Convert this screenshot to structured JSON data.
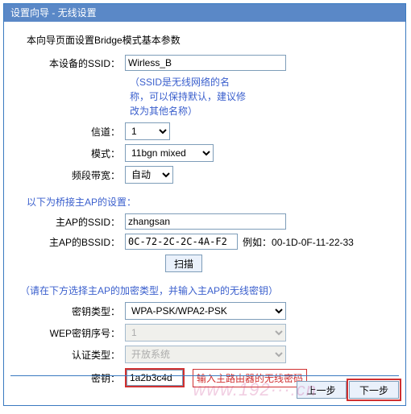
{
  "window": {
    "title": "设置向导 - 无线设置"
  },
  "intro": "本向导页面设置Bridge模式基本参数",
  "fields": {
    "device_ssid": {
      "label": "本设备的SSID：",
      "value": "Wirless_B"
    },
    "ssid_hint": "（SSID是无线网络的名称，可以保持默认，建议修改为其他名称）",
    "channel": {
      "label": "信道：",
      "value": "1"
    },
    "mode": {
      "label": "模式：",
      "value": "11bgn mixed"
    },
    "bandwidth": {
      "label": "频段带宽：",
      "value": "自动"
    }
  },
  "bridge_title": "以下为桥接主AP的设置：",
  "bridge": {
    "main_ssid": {
      "label": "主AP的SSID：",
      "value": "zhangsan"
    },
    "main_bssid": {
      "label": "主AP的BSSID：",
      "value": "0C-72-2C-2C-4A-F2",
      "example_prefix": "例如：",
      "example": "00-1D-0F-11-22-33"
    },
    "scan_btn": "扫描"
  },
  "encrypt_title": "（请在下方选择主AP的加密类型，并输入主AP的无线密钥）",
  "encrypt": {
    "type": {
      "label": "密钥类型：",
      "value": "WPA-PSK/WPA2-PSK"
    },
    "wep_index": {
      "label": "WEP密钥序号：",
      "value": "1"
    },
    "auth": {
      "label": "认证类型：",
      "value": "开放系统"
    },
    "key": {
      "label": "密钥：",
      "value": "1a2b3c4d",
      "hint": "输入主路由器的无线密码"
    }
  },
  "footer": {
    "prev": "上一步",
    "next": "下一步"
  },
  "watermark": "www.192···.cn"
}
